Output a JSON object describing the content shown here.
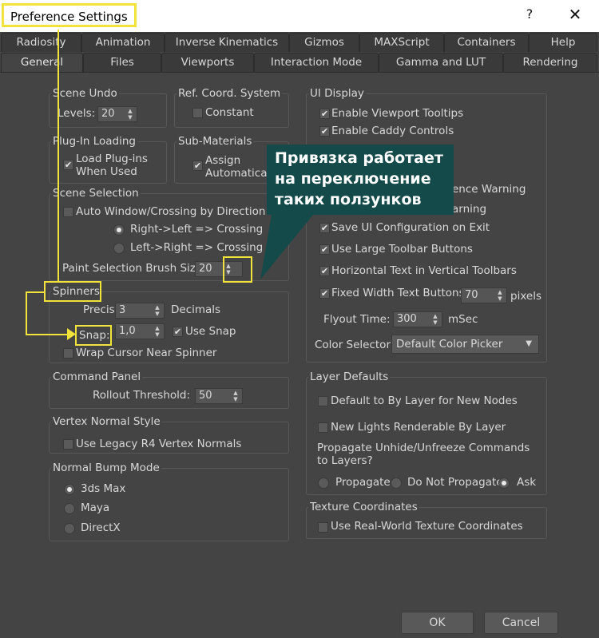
{
  "window": {
    "title": "Preference Settings",
    "help": "?",
    "close": "✕"
  },
  "tabs_row1": [
    "Radiosity",
    "Animation",
    "Inverse Kinematics",
    "Gizmos",
    "MAXScript",
    "Containers",
    "Help"
  ],
  "tabs_row2": [
    "General",
    "Files",
    "Viewports",
    "Interaction Mode",
    "Gamma and LUT",
    "Rendering"
  ],
  "active_tab": "General",
  "scene_undo": {
    "label": "Scene Undo",
    "levels_label": "Levels:",
    "levels_value": "20"
  },
  "ref_coord": {
    "label": "Ref. Coord. System",
    "constant_label": "Constant",
    "constant_checked": false
  },
  "plugin_loading": {
    "label": "Plug-In Loading",
    "load_label_1": "Load Plug-ins",
    "load_label_2": "When Used",
    "load_checked": true
  },
  "sub_materials": {
    "label": "Sub-Materials",
    "assign_label_1": "Assign",
    "assign_label_2": "Automatically",
    "assign_checked": true
  },
  "scene_selection": {
    "label": "Scene Selection",
    "auto_window_label": "Auto Window/Crossing by Direction",
    "auto_window_checked": false,
    "rl_label": "Right->Left => Crossing",
    "lr_label": "Left->Right => Crossing",
    "rl_selected": true,
    "paint_brush_label": "Paint Selection Brush Size",
    "paint_brush_value": "20"
  },
  "spinners": {
    "label": "Spinners",
    "precision_label": "Precision:",
    "precision_value": "3",
    "decimals_label": "Decimals",
    "snap_label": "Snap:",
    "snap_value": "1,0",
    "use_snap_label": "Use Snap",
    "use_snap_checked": true,
    "wrap_label": "Wrap Cursor Near Spinner",
    "wrap_checked": false
  },
  "command_panel": {
    "label": "Command Panel",
    "rollout_label": "Rollout Threshold:",
    "rollout_value": "50"
  },
  "vertex_normal": {
    "label": "Vertex Normal Style",
    "legacy_label": "Use Legacy R4 Vertex Normals",
    "legacy_checked": false
  },
  "normal_bump": {
    "label": "Normal Bump Mode",
    "options": [
      "3ds Max",
      "Maya",
      "DirectX"
    ],
    "selected": "3ds Max"
  },
  "ui_display": {
    "label": "UI Display",
    "tooltips_label": "Enable Viewport Tooltips",
    "caddy_label": "Enable Caddy Controls",
    "hidden_1_label": "ence Warning",
    "hidden_2_label": "arning",
    "save_ui_label": "Save UI Configuration on Exit",
    "large_toolbar_label": "Use Large Toolbar Buttons",
    "horizontal_text_label": "Horizontal Text in Vertical Toolbars",
    "fixed_width_label": "Fixed Width Text Buttons:",
    "fixed_width_value": "70",
    "pixels_label": "pixels",
    "flyout_label": "Flyout Time:",
    "flyout_value": "300",
    "msec_label": "mSec",
    "color_selector_label": "Color Selector:",
    "color_selector_value": "Default Color Picker"
  },
  "layer_defaults": {
    "label": "Layer Defaults",
    "default_by_layer_label": "Default to By Layer for New Nodes",
    "new_lights_label": "New Lights Renderable By Layer",
    "propagate_label_1": "Propagate Unhide/Unfreeze Commands",
    "propagate_label_2": "to Layers?",
    "propagate_options": [
      "Propagate",
      "Do Not Propagate",
      "Ask"
    ],
    "propagate_selected": "Ask"
  },
  "texture_coords": {
    "label": "Texture Coordinates",
    "real_world_label": "Use Real-World Texture Coordinates"
  },
  "callout": {
    "line1": "Привязка работает",
    "line2": "на переключение",
    "line3": "таких ползунков"
  },
  "buttons": {
    "ok": "OK",
    "cancel": "Cancel"
  },
  "colors": {
    "background": "#444444",
    "highlight": "#f2e33a",
    "callout_bg": "#154a4a"
  },
  "icons": {
    "check": "check-icon",
    "spinner_arrows": "spinner-arrows-icon",
    "dropdown_caret": "caret-down-icon"
  }
}
